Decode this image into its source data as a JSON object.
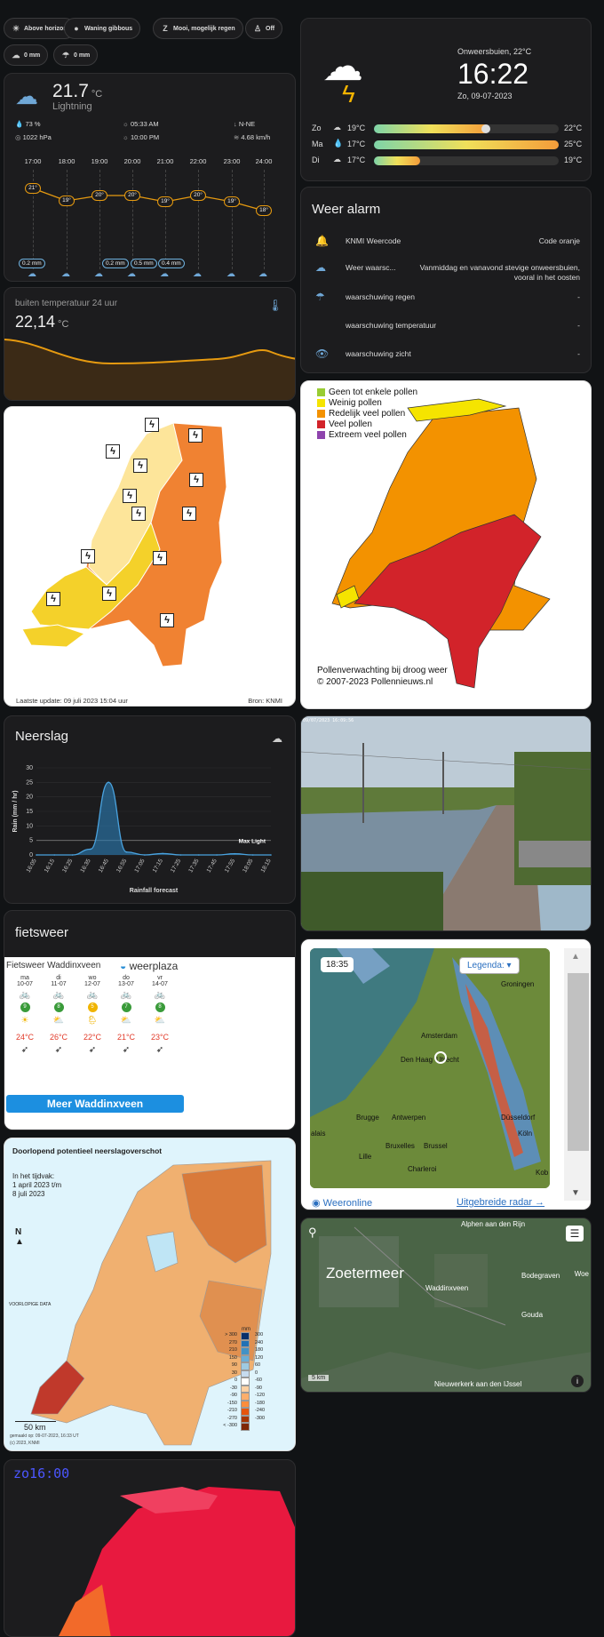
{
  "chips": [
    {
      "icon": "sun-horizon-icon",
      "label": "Above horizon"
    },
    {
      "icon": "moon-icon",
      "label": "Waning gibbous"
    },
    {
      "icon": "forecast-icon",
      "label": "Mooi, mogelijk regen"
    },
    {
      "icon": "person-icon",
      "label": "Off"
    },
    {
      "icon": "cloud-up-icon",
      "label": "0 mm"
    },
    {
      "icon": "cloud-rain-icon",
      "label": "0 mm"
    }
  ],
  "weather": {
    "temp": "21.7",
    "unit": "°C",
    "condition": "Lightning",
    "humidity": "73 %",
    "sunrise": "05:33 AM",
    "wind_dir": "N-NE",
    "pressure": "1022 hPa",
    "sunset": "10:00 PM",
    "wind_speed": "4.68 km/h",
    "hours": [
      "17:00",
      "18:00",
      "19:00",
      "20:00",
      "21:00",
      "22:00",
      "23:00",
      "24:00"
    ],
    "hourly_temps": [
      "21°",
      "19°",
      "20°",
      "20°",
      "19°",
      "20°",
      "19°",
      "18°"
    ],
    "rain": [
      "0.2 mm",
      "0.2 mm",
      "0.5 mm",
      "0.4 mm"
    ]
  },
  "outside": {
    "title": "buiten temperatuur 24 uur",
    "value": "22,14",
    "unit": "°C"
  },
  "clock": {
    "condition": "Onweersbuien, 22°C",
    "time": "16:22",
    "date": "Zo, 09-07-2023",
    "days": [
      {
        "day": "Zo",
        "low": "19°C",
        "high": "22°C",
        "fill": 0.62
      },
      {
        "day": "Ma",
        "low": "17°C",
        "high": "25°C",
        "fill": 1.0
      },
      {
        "day": "Di",
        "low": "17°C",
        "high": "19°C",
        "fill": 0.25
      }
    ]
  },
  "alarm": {
    "title": "Weer alarm",
    "rows": [
      {
        "label": "KNMI Weercode",
        "value": "Code oranje"
      },
      {
        "label": "Weer waarsc...",
        "value": "Vanmiddag en vanavond stevige onweersbuien, vooral in het oosten"
      },
      {
        "label": "waarschuwing regen",
        "value": "-"
      },
      {
        "label": "waarschuwing temperatuur",
        "value": "-"
      },
      {
        "label": "waarschuwing zicht",
        "value": "-"
      }
    ]
  },
  "knmi": {
    "update": "Laatste update: 09 juli 2023 15:04 uur",
    "source": "Bron: KNMI"
  },
  "pollen": {
    "legend": [
      "Geen tot enkele pollen",
      "Weinig pollen",
      "Redelijk veel pollen",
      "Veel pollen",
      "Extreem veel pollen"
    ],
    "legend_colors": [
      "#99cc33",
      "#f5e400",
      "#f39200",
      "#d2232a",
      "#8e44ad"
    ],
    "footer1": "Pollenverwachting bij droog weer",
    "footer2": "© 2007-2023 Pollennieuws.nl"
  },
  "neerslag": {
    "title": "Neerslag",
    "ylabel": "Rain (mm / hr)",
    "xlabel": "Rainfall forecast",
    "threshold": "Max Light",
    "chart_data": {
      "type": "area",
      "x": [
        "16:05",
        "16:15",
        "16:25",
        "16:35",
        "16:45",
        "16:55",
        "17:05",
        "17:15",
        "17:25",
        "17:35",
        "17:45",
        "17:55",
        "18:05",
        "18:15"
      ],
      "values": [
        0,
        0,
        0,
        2,
        25,
        1,
        0,
        0.5,
        0,
        0,
        0,
        0.4,
        0,
        0
      ],
      "ylim": [
        0,
        30
      ],
      "yticks": [
        0,
        5,
        10,
        15,
        20,
        25,
        30
      ],
      "ylabel": "Rain (mm / hr)",
      "xlabel": "Rainfall forecast"
    }
  },
  "webcam": {
    "stamp": "09/07/2023 16:09:56"
  },
  "fietsweer": {
    "title": "fietsweer",
    "place": "Fietsweer Waddinxveen",
    "brand": "weerplaza",
    "button": "Meer Waddinxveen",
    "days": [
      {
        "d": "ma",
        "date": "10-07",
        "score": "9",
        "temp": "24°C"
      },
      {
        "d": "di",
        "date": "11-07",
        "score": "8",
        "temp": "26°C"
      },
      {
        "d": "wo",
        "date": "12-07",
        "score": "5",
        "temp": "22°C"
      },
      {
        "d": "do",
        "date": "13-07",
        "score": "7",
        "temp": "21°C"
      },
      {
        "d": "vr",
        "date": "14-07",
        "score": "8",
        "temp": "23°C"
      }
    ],
    "score_colors": [
      "#3a9b3a",
      "#3a9b3a",
      "#f0b400",
      "#3a9b3a",
      "#3a9b3a"
    ]
  },
  "radar": {
    "time": "18:35",
    "legend": "Legenda:",
    "cities": [
      "Groningen",
      "Amsterdam",
      "Den Haag",
      "Utrecht",
      "Brugge",
      "Antwerpen",
      "Düsseldorf",
      "Köln",
      "Lille",
      "Bruxelles",
      "Brussel",
      "Charleroi",
      "Kob",
      "alais"
    ],
    "brand": "Weeronline",
    "link": "Uitgebreide radar →"
  },
  "drought": {
    "title": "Doorlopend potentieel neerslagoverschot",
    "period1": "In het tijdvak:",
    "period2": "1 april 2023 t/m",
    "period3": "8 juli 2023",
    "prelim": "VOORLOPIGE DATA",
    "scale": "50 km",
    "made": "gemaakt op: 09-07-2023, 16:33 UT",
    "copy": "(c) 2023, KNMI",
    "unit": "mm",
    "legend": [
      [
        "> 300",
        "300"
      ],
      [
        "270",
        "240"
      ],
      [
        "210",
        "180"
      ],
      [
        "150",
        "120"
      ],
      [
        "90",
        "60"
      ],
      [
        "30",
        "0"
      ],
      [
        "0",
        "-60"
      ],
      [
        "-30",
        "-90"
      ],
      [
        "-90",
        "-120"
      ],
      [
        "-150",
        "-180"
      ],
      [
        "-210",
        "-240"
      ],
      [
        "-270",
        "-300"
      ],
      [
        "< -300",
        ""
      ]
    ]
  },
  "satmap": {
    "labels": [
      "Alphen aan den Rijn",
      "Zoetermeer",
      "Bodegraven",
      "Waddinxveen",
      "Gouda",
      "Nieuwerkerk aan den IJssel",
      "Woe"
    ],
    "scale": "5 km"
  },
  "uv": {
    "time": "zo16:00"
  }
}
